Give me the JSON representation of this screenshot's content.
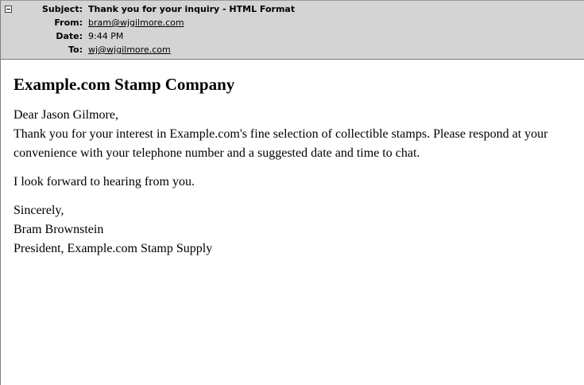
{
  "header": {
    "subject_label": "Subject:",
    "subject": "Thank you for your inquiry - HTML Format",
    "from_label": "From:",
    "from": "bram@wjgilmore.com",
    "date_label": "Date:",
    "date": "9:44 PM",
    "to_label": "To:",
    "to": "wj@wjgilmore.com",
    "header_bg": "#d4d4d4"
  },
  "message": {
    "company_title": "Example.com Stamp Company",
    "greeting": "Dear Jason Gilmore,",
    "body_paragraph": "Thank you for your interest in Example.com's fine selection of collectible stamps. Please respond at your convenience with your telephone number and a suggested date and time to chat.",
    "closing_line": "I look forward to hearing from you.",
    "signoff": "Sincerely,",
    "sender_name": "Bram Brownstein",
    "sender_title": "President, Example.com Stamp Supply"
  },
  "icons": {
    "collapse": "minus-box-icon"
  }
}
